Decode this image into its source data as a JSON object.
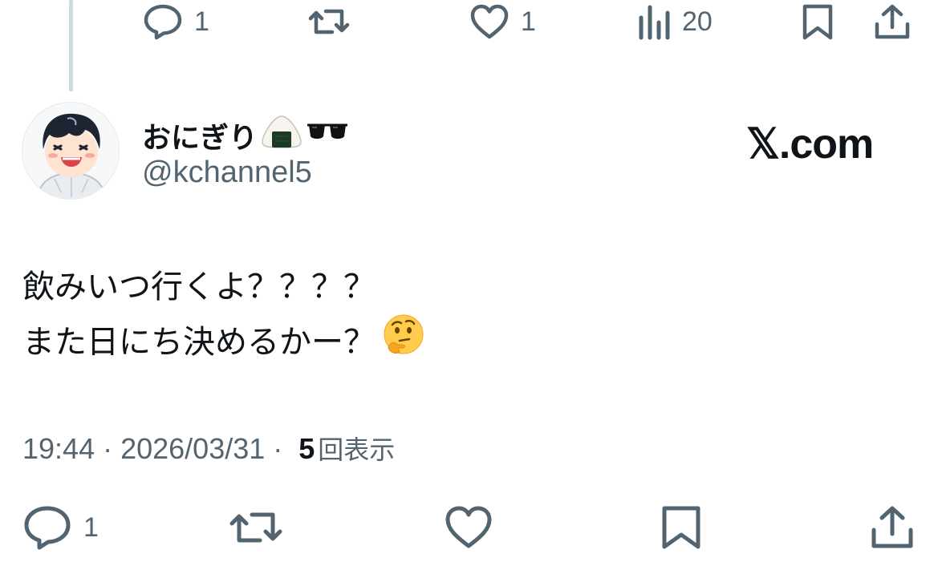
{
  "parent_tweet": {
    "actions": {
      "reply_count": "1",
      "like_count": "1",
      "view_count": "20"
    }
  },
  "tweet": {
    "author": {
      "display_name": "おにぎり",
      "display_name_emojis": [
        "rice-ball-emoji",
        "sunglasses-emoji"
      ],
      "handle": "@kchannel5"
    },
    "watermark": "𝕏.com",
    "text_lines": [
      "飲みいつ行くよ？？？？",
      "また日にち決めるかー？"
    ],
    "text_emoji": "thinking-face-emoji",
    "timestamp": "19:44 · 2026/03/31 ·",
    "views_count": "5",
    "views_label": "回表示",
    "actions": {
      "reply_count": "1"
    }
  },
  "colors": {
    "text_primary": "#0f1419",
    "text_secondary": "#536471",
    "thread_line": "#cfd9de",
    "background": "#ffffff"
  }
}
